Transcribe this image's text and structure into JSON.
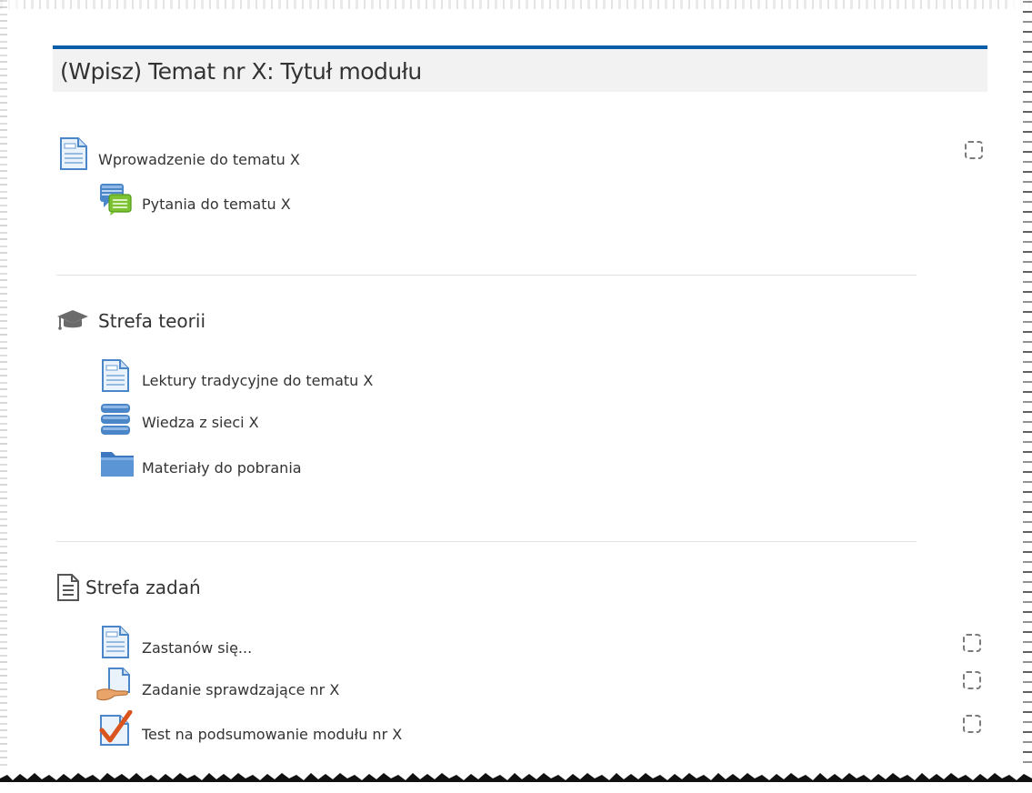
{
  "section": {
    "title": "(Wpisz) Temat nr X: Tytuł modułu"
  },
  "intro": {
    "items": [
      {
        "label": "Wprowadzenie do tematu X",
        "icon": "page-icon",
        "completion": true
      },
      {
        "label": "Pytania do tematu X",
        "icon": "forum-icon",
        "completion": false
      }
    ]
  },
  "theory": {
    "heading": "Strefa teorii",
    "icon": "graduation-cap-icon",
    "items": [
      {
        "label": "Lektury tradycyjne do tematu X",
        "icon": "page-icon"
      },
      {
        "label": "Wiedza z sieci X",
        "icon": "database-icon"
      },
      {
        "label": "Materiały do pobrania",
        "icon": "folder-icon"
      }
    ]
  },
  "tasks": {
    "heading": "Strefa zadań",
    "icon": "document-icon",
    "items": [
      {
        "label": "Zastanów się...",
        "icon": "page-icon",
        "completion": true
      },
      {
        "label": "Zadanie sprawdzające nr X",
        "icon": "assignment-icon",
        "completion": true
      },
      {
        "label": "Test na podsumowanie modułu nr X",
        "icon": "quiz-checkmark-icon",
        "completion": true
      }
    ]
  },
  "colors": {
    "accent": "#0a5ea9",
    "header_bg": "#f2f2f2"
  }
}
